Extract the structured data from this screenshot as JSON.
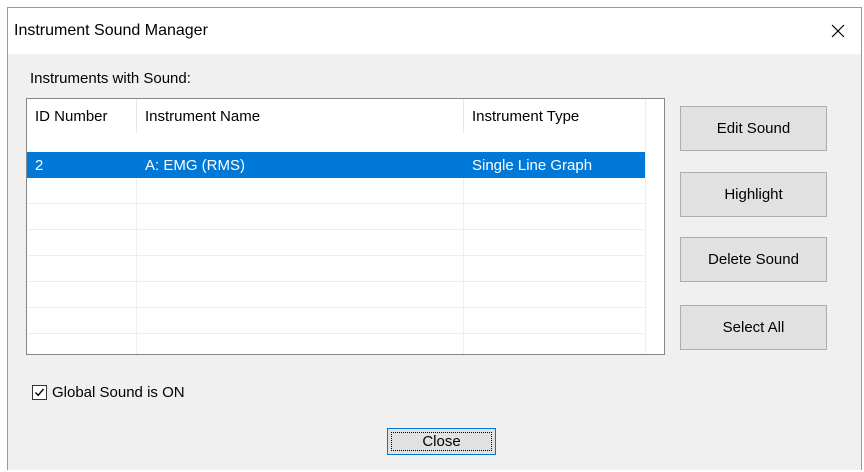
{
  "window": {
    "title": "Instrument Sound Manager",
    "close_icon": "close-icon"
  },
  "list": {
    "label": "Instruments with Sound:",
    "columns": [
      "ID Number",
      "Instrument Name",
      "Instrument Type"
    ],
    "rows": [
      {
        "id": "2",
        "name": "A: EMG (RMS)",
        "type": "Single Line Graph",
        "selected": true
      }
    ],
    "empty_rows": 7
  },
  "buttons": {
    "edit_sound": "Edit Sound",
    "highlight": "Highlight",
    "delete_sound": "Delete Sound",
    "select_all": "Select All",
    "close": "Close"
  },
  "global_sound": {
    "label": "Global Sound is ON",
    "checked": true
  },
  "colors": {
    "selection": "#0078d7",
    "dialog_bg": "#f0f0f0",
    "button_bg": "#e1e1e1"
  }
}
